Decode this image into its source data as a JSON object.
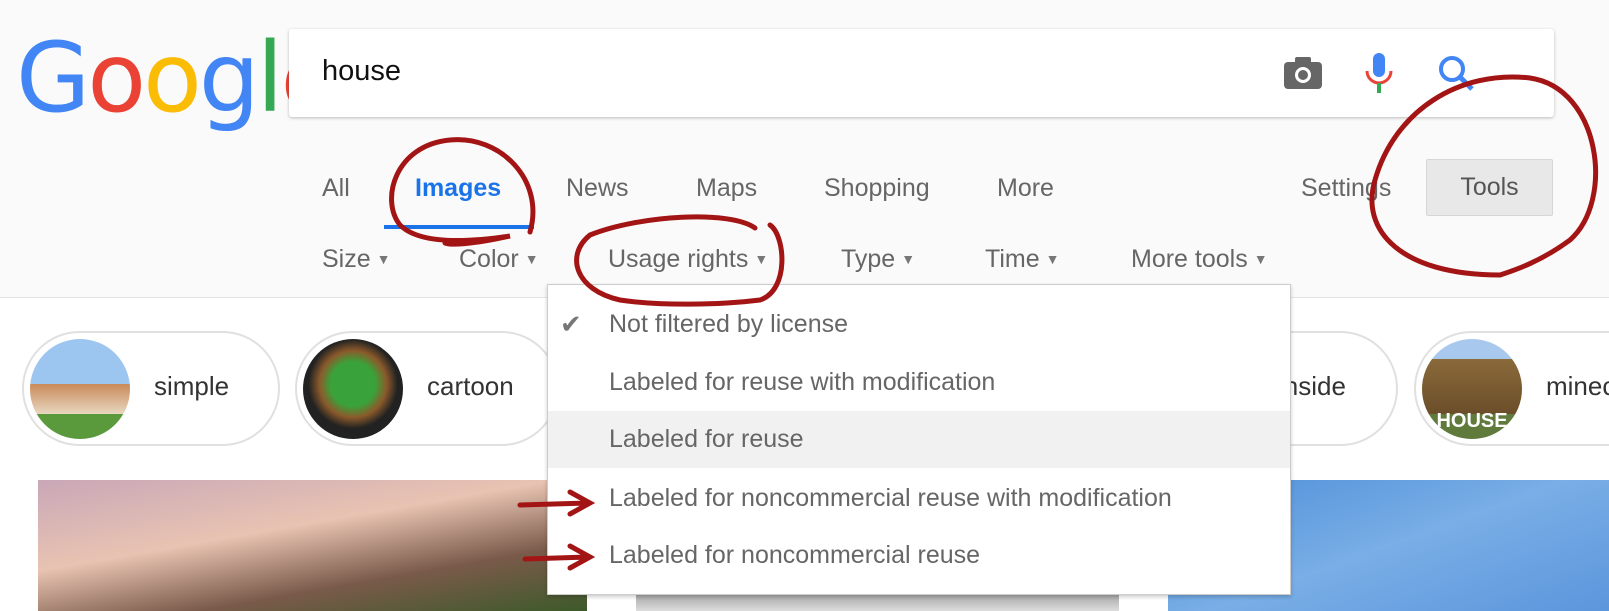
{
  "logo": {
    "text": "Google",
    "letters": [
      {
        "c": "G",
        "color": "#4285f4"
      },
      {
        "c": "o",
        "color": "#ea4335"
      },
      {
        "c": "o",
        "color": "#fbbc05"
      },
      {
        "c": "g",
        "color": "#4285f4"
      },
      {
        "c": "l",
        "color": "#34a853"
      },
      {
        "c": "e",
        "color": "#ea4335"
      }
    ]
  },
  "search": {
    "query": "house",
    "icons": [
      "camera-icon",
      "microphone-icon",
      "search-icon"
    ]
  },
  "tabs": [
    {
      "label": "All"
    },
    {
      "label": "Images",
      "active": true
    },
    {
      "label": "News"
    },
    {
      "label": "Maps"
    },
    {
      "label": "Shopping"
    },
    {
      "label": "More"
    }
  ],
  "settings_label": "Settings",
  "tools_label": "Tools",
  "tools": [
    {
      "label": "Size"
    },
    {
      "label": "Color"
    },
    {
      "label": "Usage rights"
    },
    {
      "label": "Type"
    },
    {
      "label": "Time"
    },
    {
      "label": "More tools"
    }
  ],
  "usage_menu": {
    "items": [
      {
        "label": "Not filtered by license",
        "checked": true
      },
      {
        "label": "Labeled for reuse with modification"
      },
      {
        "label": "Labeled for reuse",
        "highlighted": true
      },
      {
        "label": "Labeled for noncommercial reuse with modification"
      },
      {
        "label": "Labeled for noncommercial reuse"
      }
    ]
  },
  "chips": [
    {
      "label": "simple"
    },
    {
      "label": "cartoon"
    },
    {
      "label": "inside"
    },
    {
      "label": "minecraft",
      "thumb_text": "HOUSE"
    }
  ],
  "colors": {
    "accent": "#1a73e8",
    "annotation": "#a31515"
  }
}
